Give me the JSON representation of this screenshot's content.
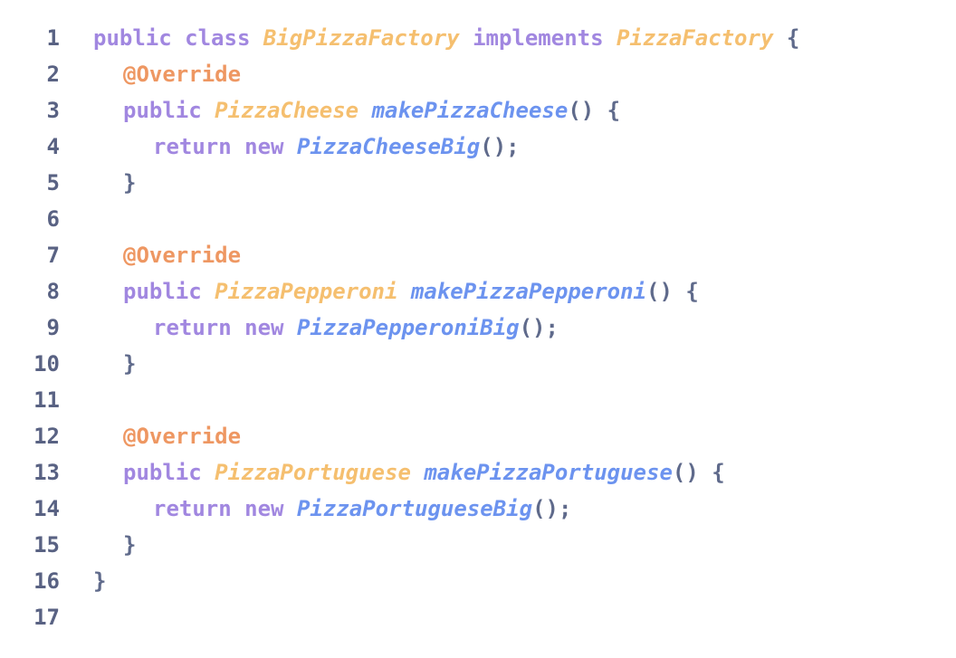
{
  "colors": {
    "line_number": "#596283",
    "keyword": "#a187e0",
    "type": "#f5bf6f",
    "function": "#6c93ef",
    "annotation": "#ee9762",
    "punctuation": "#5f6a8b",
    "background": "#ffffff"
  },
  "code": {
    "lines": [
      {
        "n": "1",
        "indent": 0,
        "tokens": [
          {
            "t": "public",
            "k": "kw"
          },
          {
            "t": " ",
            "k": "sp"
          },
          {
            "t": "class",
            "k": "kw"
          },
          {
            "t": " ",
            "k": "sp"
          },
          {
            "t": "BigPizzaFactory",
            "k": "type"
          },
          {
            "t": " ",
            "k": "sp"
          },
          {
            "t": "implements",
            "k": "kw"
          },
          {
            "t": " ",
            "k": "sp"
          },
          {
            "t": "PizzaFactory",
            "k": "type"
          },
          {
            "t": " ",
            "k": "sp"
          },
          {
            "t": "{",
            "k": "punc"
          }
        ]
      },
      {
        "n": "2",
        "indent": 1,
        "tokens": [
          {
            "t": "@Override",
            "k": "ann"
          }
        ]
      },
      {
        "n": "3",
        "indent": 1,
        "tokens": [
          {
            "t": "public",
            "k": "kw"
          },
          {
            "t": " ",
            "k": "sp"
          },
          {
            "t": "PizzaCheese",
            "k": "type"
          },
          {
            "t": " ",
            "k": "sp"
          },
          {
            "t": "makePizzaCheese",
            "k": "fn"
          },
          {
            "t": "() {",
            "k": "punc"
          }
        ]
      },
      {
        "n": "4",
        "indent": 2,
        "tokens": [
          {
            "t": "return",
            "k": "kw"
          },
          {
            "t": " ",
            "k": "sp"
          },
          {
            "t": "new",
            "k": "kw"
          },
          {
            "t": " ",
            "k": "sp"
          },
          {
            "t": "PizzaCheeseBig",
            "k": "fn"
          },
          {
            "t": "();",
            "k": "punc"
          }
        ]
      },
      {
        "n": "5",
        "indent": 1,
        "tokens": [
          {
            "t": "}",
            "k": "punc"
          }
        ]
      },
      {
        "n": "6",
        "indent": 0,
        "tokens": []
      },
      {
        "n": "7",
        "indent": 1,
        "tokens": [
          {
            "t": "@Override",
            "k": "ann"
          }
        ]
      },
      {
        "n": "8",
        "indent": 1,
        "tokens": [
          {
            "t": "public",
            "k": "kw"
          },
          {
            "t": " ",
            "k": "sp"
          },
          {
            "t": "PizzaPepperoni",
            "k": "type"
          },
          {
            "t": " ",
            "k": "sp"
          },
          {
            "t": "makePizzaPepperoni",
            "k": "fn"
          },
          {
            "t": "() {",
            "k": "punc"
          }
        ]
      },
      {
        "n": "9",
        "indent": 2,
        "tokens": [
          {
            "t": "return",
            "k": "kw"
          },
          {
            "t": " ",
            "k": "sp"
          },
          {
            "t": "new",
            "k": "kw"
          },
          {
            "t": " ",
            "k": "sp"
          },
          {
            "t": "PizzaPepperoniBig",
            "k": "fn"
          },
          {
            "t": "();",
            "k": "punc"
          }
        ]
      },
      {
        "n": "10",
        "indent": 1,
        "tokens": [
          {
            "t": "}",
            "k": "punc"
          }
        ]
      },
      {
        "n": "11",
        "indent": 0,
        "tokens": []
      },
      {
        "n": "12",
        "indent": 1,
        "tokens": [
          {
            "t": "@Override",
            "k": "ann"
          }
        ]
      },
      {
        "n": "13",
        "indent": 1,
        "tokens": [
          {
            "t": "public",
            "k": "kw"
          },
          {
            "t": " ",
            "k": "sp"
          },
          {
            "t": "PizzaPortuguese",
            "k": "type"
          },
          {
            "t": " ",
            "k": "sp"
          },
          {
            "t": "makePizzaPortuguese",
            "k": "fn"
          },
          {
            "t": "() {",
            "k": "punc"
          }
        ]
      },
      {
        "n": "14",
        "indent": 2,
        "tokens": [
          {
            "t": "return",
            "k": "kw"
          },
          {
            "t": " ",
            "k": "sp"
          },
          {
            "t": "new",
            "k": "kw"
          },
          {
            "t": " ",
            "k": "sp"
          },
          {
            "t": "PizzaPortugueseBig",
            "k": "fn"
          },
          {
            "t": "();",
            "k": "punc"
          }
        ]
      },
      {
        "n": "15",
        "indent": 1,
        "tokens": [
          {
            "t": "}",
            "k": "punc"
          }
        ]
      },
      {
        "n": "16",
        "indent": 0,
        "tokens": [
          {
            "t": "}",
            "k": "punc"
          }
        ]
      },
      {
        "n": "17",
        "indent": 0,
        "tokens": []
      }
    ]
  }
}
